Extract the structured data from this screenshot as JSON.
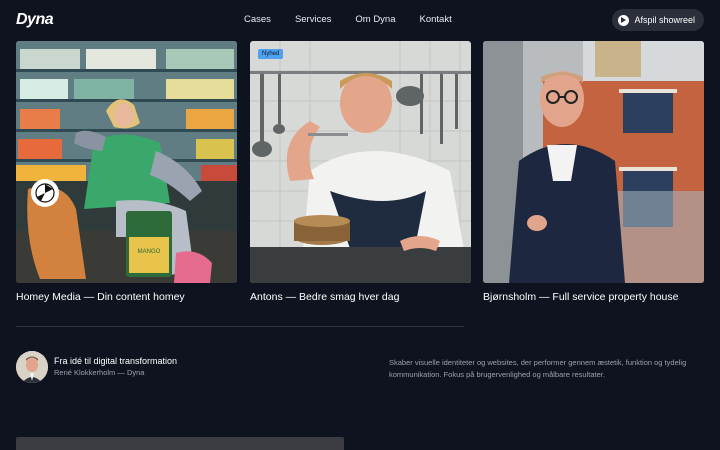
{
  "header": {
    "logo": "Dyna",
    "nav": [
      "Cases",
      "Services",
      "Om Dyna",
      "Kontakt"
    ],
    "showreel_label": "Afspil showreel",
    "showreel_icon": "play-icon"
  },
  "cards": [
    {
      "caption": "Homey Media — Din content homey",
      "product_text": "MANGO"
    },
    {
      "caption": "Antons — Bedre smag hver dag",
      "badge": "Nyhed"
    },
    {
      "caption": "Bjørnsholm — Full service property house"
    }
  ],
  "about": {
    "title": "Fra idé til digital transformation",
    "subtitle": "René Klokkerholm — Dyna",
    "description": "Skaber visuelle identiteter og websites, der performer gennem æstetik, funktion og tydelig kommunikation. Fokus på brugervenlighed og målbare resultater."
  },
  "colors": {
    "background": "#0f1320",
    "badge": "#4ea1f0",
    "muted_text": "#9aa0ad"
  }
}
